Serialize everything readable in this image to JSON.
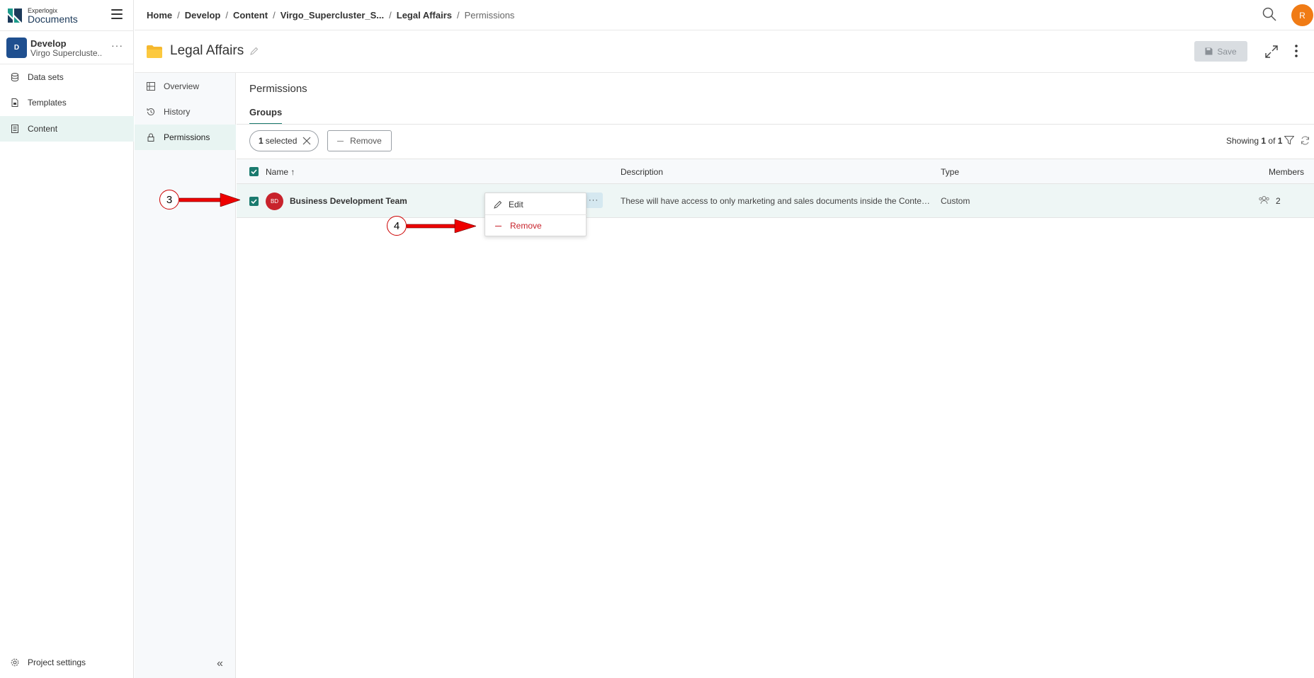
{
  "app": {
    "logo_small": "Experlogix",
    "logo_big": "Documents"
  },
  "project": {
    "avatar": "D",
    "name": "Develop",
    "subtitle": "Virgo Supercluste...",
    "more": "···"
  },
  "sidebar": {
    "items": [
      {
        "label": "Data sets",
        "icon": "database-icon"
      },
      {
        "label": "Templates",
        "icon": "template-icon"
      },
      {
        "label": "Content",
        "icon": "content-icon",
        "active": true
      }
    ],
    "footer_label": "Project settings",
    "collapse": "«"
  },
  "breadcrumb": [
    {
      "label": "Home"
    },
    {
      "label": "Develop"
    },
    {
      "label": "Content"
    },
    {
      "label": "Virgo_Supercluster_S..."
    },
    {
      "label": "Legal Affairs"
    },
    {
      "label": "Permissions"
    }
  ],
  "user": {
    "avatar": "R"
  },
  "title": {
    "text": "Legal Affairs",
    "save_label": "Save"
  },
  "subnav": {
    "items": [
      {
        "label": "Overview"
      },
      {
        "label": "History"
      },
      {
        "label": "Permissions",
        "active": true
      }
    ]
  },
  "main": {
    "section_title": "Permissions",
    "tab": "Groups",
    "selected_count": "1",
    "selected_label": "selected",
    "remove_label": "Remove",
    "showing_prefix": "Showing",
    "showing_current": "1",
    "showing_of": "of",
    "showing_total": "1"
  },
  "table": {
    "columns": {
      "name": "Name",
      "sort": "↑",
      "description": "Description",
      "type": "Type",
      "members": "Members"
    },
    "rows": [
      {
        "avatar": "BD",
        "name": "Business Development Team",
        "more": "···",
        "description": "These will have access to only marketing and sales documents inside the Content Man...",
        "type": "Custom",
        "members": "2"
      }
    ]
  },
  "context_menu": {
    "edit_label": "Edit",
    "remove_label": "Remove"
  },
  "annotations": {
    "step3": "3",
    "step4": "4"
  },
  "colors": {
    "accent": "#1a7a6e",
    "user_avatar": "#f07b15",
    "danger": "#c8232c",
    "project_avatar": "#1f4f8f"
  }
}
